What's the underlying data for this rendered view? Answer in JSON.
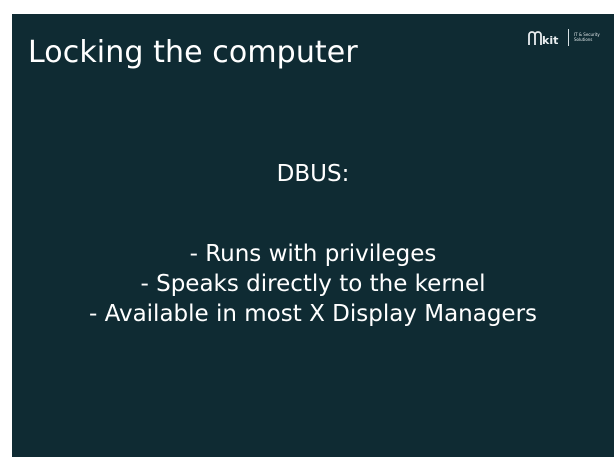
{
  "slide": {
    "title": "Locking the computer",
    "section_label": "DBUS:",
    "bullets": [
      "- Runs with privileges",
      "- Speaks directly to the kernel",
      "- Available in most X Display Managers"
    ],
    "background_color": "#0f2b33",
    "text_color": "#ffffff"
  },
  "logo": {
    "wordmark": "kit",
    "tagline_line1": "IT & Security",
    "tagline_line2": "Solutions"
  }
}
